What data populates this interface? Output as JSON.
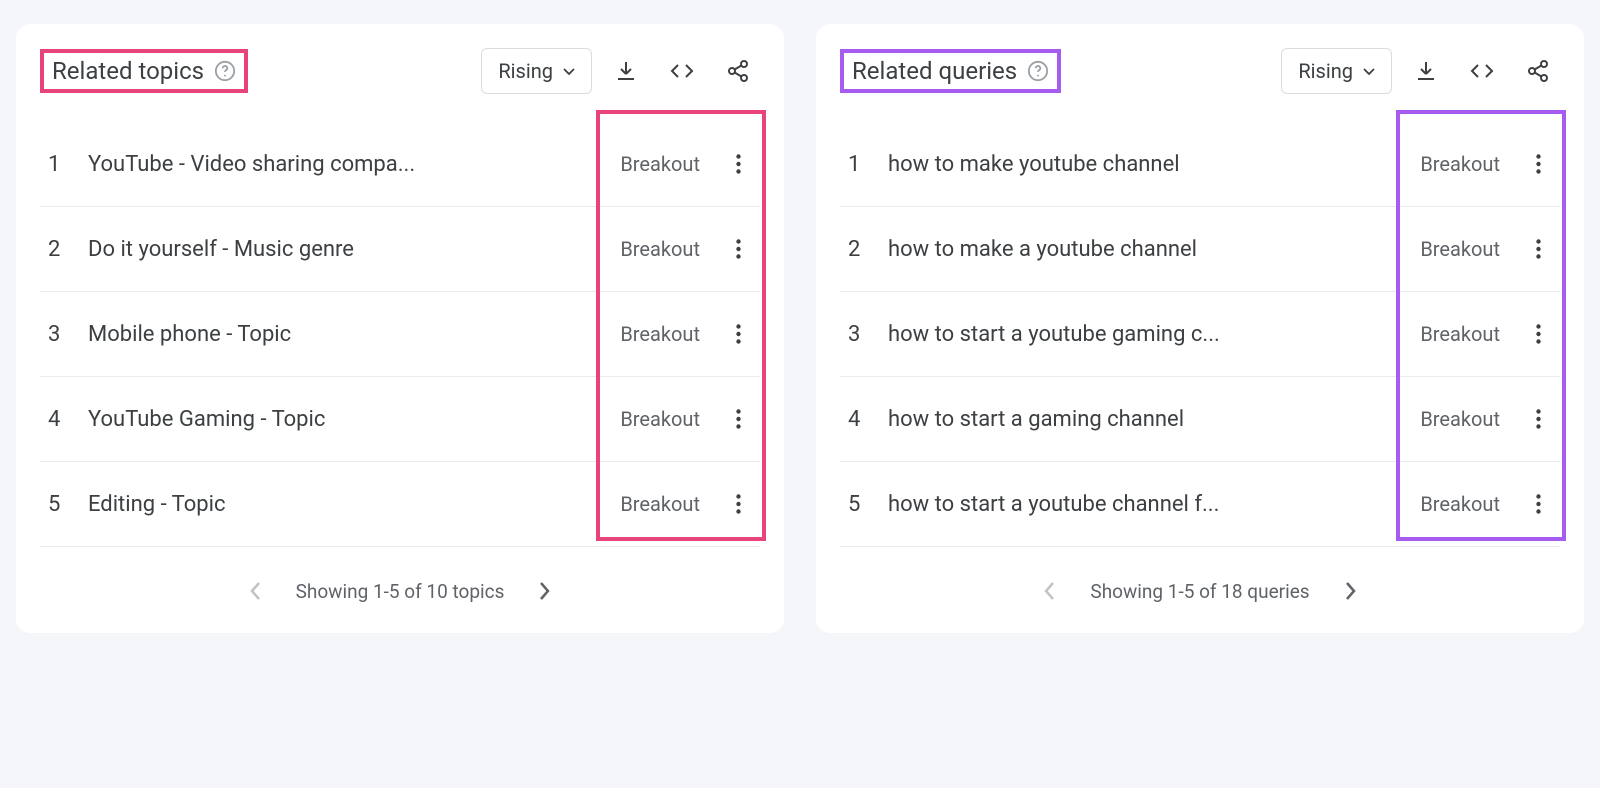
{
  "panels": [
    {
      "id": "related-topics",
      "title": "Related topics",
      "highlight_color": "pink",
      "dropdown_label": "Rising",
      "pager_text": "Showing 1-5 of 10 topics",
      "rows": [
        {
          "rank": "1",
          "label": "YouTube - Video sharing compa...",
          "value": "Breakout"
        },
        {
          "rank": "2",
          "label": "Do it yourself - Music genre",
          "value": "Breakout"
        },
        {
          "rank": "3",
          "label": "Mobile phone - Topic",
          "value": "Breakout"
        },
        {
          "rank": "4",
          "label": "YouTube Gaming - Topic",
          "value": "Breakout"
        },
        {
          "rank": "5",
          "label": "Editing - Topic",
          "value": "Breakout"
        }
      ]
    },
    {
      "id": "related-queries",
      "title": "Related queries",
      "highlight_color": "purple",
      "dropdown_label": "Rising",
      "pager_text": "Showing 1-5 of 18 queries",
      "rows": [
        {
          "rank": "1",
          "label": "how to make youtube channel",
          "value": "Breakout"
        },
        {
          "rank": "2",
          "label": "how to make a youtube channel",
          "value": "Breakout"
        },
        {
          "rank": "3",
          "label": "how to start a youtube gaming c...",
          "value": "Breakout"
        },
        {
          "rank": "4",
          "label": "how to start a gaming channel",
          "value": "Breakout"
        },
        {
          "rank": "5",
          "label": "how to start a youtube channel f...",
          "value": "Breakout"
        }
      ]
    }
  ]
}
